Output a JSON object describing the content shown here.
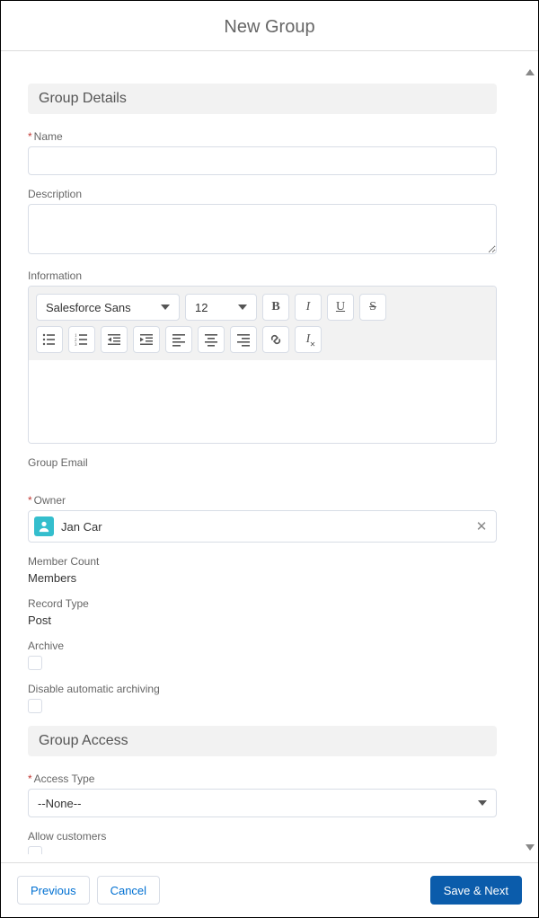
{
  "modal": {
    "title": "New Group"
  },
  "sections": {
    "details": {
      "header": "Group Details",
      "name": {
        "label": "Name",
        "value": ""
      },
      "description": {
        "label": "Description",
        "value": ""
      },
      "information": {
        "label": "Information",
        "font": "Salesforce Sans",
        "size": "12"
      },
      "group_email": {
        "label": "Group Email"
      },
      "owner": {
        "label": "Owner",
        "value": "Jan Car"
      },
      "member_count": {
        "label": "Member Count",
        "value": "Members"
      },
      "record_type": {
        "label": "Record Type",
        "value": "Post"
      },
      "archive": {
        "label": "Archive",
        "checked": false
      },
      "disable_auto_archive": {
        "label": "Disable automatic archiving",
        "checked": false
      }
    },
    "access": {
      "header": "Group Access",
      "access_type": {
        "label": "Access Type",
        "value": "--None--"
      },
      "allow_customers": {
        "label": "Allow customers",
        "checked": false
      }
    }
  },
  "footer": {
    "previous": "Previous",
    "cancel": "Cancel",
    "save_next": "Save & Next"
  }
}
